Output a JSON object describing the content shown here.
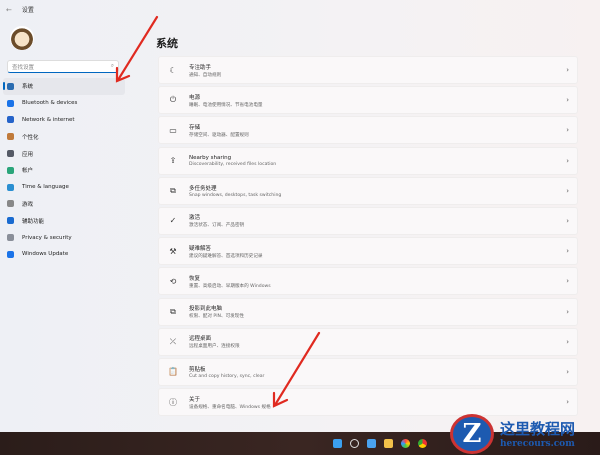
{
  "window": {
    "back": "←",
    "title": "设置"
  },
  "search": {
    "placeholder": "查找设置",
    "icon": "⌕"
  },
  "nav": [
    {
      "label": "系统",
      "color": "#2b6cb0"
    },
    {
      "label": "Bluetooth & devices",
      "color": "#1a73e8"
    },
    {
      "label": "Network & internet",
      "color": "#2563c9"
    },
    {
      "label": "个性化",
      "color": "#c07a3a"
    },
    {
      "label": "应用",
      "color": "#555a66"
    },
    {
      "label": "帐户",
      "color": "#2aa57a"
    },
    {
      "label": "Time & language",
      "color": "#2a8fd1"
    },
    {
      "label": "游戏",
      "color": "#888"
    },
    {
      "label": "辅助功能",
      "color": "#1a6bd0"
    },
    {
      "label": "Privacy & security",
      "color": "#8a8f99"
    },
    {
      "label": "Windows Update",
      "color": "#1a73e8"
    }
  ],
  "main": {
    "heading": "系统",
    "cards": [
      {
        "icon": "☾",
        "title": "专注助手",
        "sub": "通知、自动规则"
      },
      {
        "icon": "⏻",
        "title": "电源",
        "sub": "睡眠、电池使用情况、节省电池电量"
      },
      {
        "icon": "▭",
        "title": "存储",
        "sub": "存储空间、驱动器、配置规则"
      },
      {
        "icon": "⇪",
        "title": "Nearby sharing",
        "sub": "Discoverability, received files location"
      },
      {
        "icon": "⧉",
        "title": "多任务处理",
        "sub": "Snap windows, desktops, task switching"
      },
      {
        "icon": "✓",
        "title": "激活",
        "sub": "激活状态、订阅、产品密钥"
      },
      {
        "icon": "⚒",
        "title": "疑难解答",
        "sub": "建议的疑难解答、首选项和历史记录"
      },
      {
        "icon": "⟲",
        "title": "恢复",
        "sub": "重置、高级启动、早期版本的 Windows"
      },
      {
        "icon": "⧉",
        "title": "投影到此电脑",
        "sub": "权限、配对 PIN、可发现性"
      },
      {
        "icon": "⤫",
        "title": "远程桌面",
        "sub": "远程桌面用户、连接权限"
      },
      {
        "icon": "📋",
        "title": "剪贴板",
        "sub": "Cut and copy history, sync, clear"
      },
      {
        "icon": "ⓘ",
        "title": "关于",
        "sub": "设备规格、重命名电脑、Windows 规格"
      }
    ],
    "chevron": "›"
  },
  "watermark": {
    "letter": "Z",
    "cn": "这里教程网",
    "en": "herecours.com"
  },
  "colors": {
    "accent": "#0067c0",
    "arrow": "#e02a20",
    "taskbar": "#2f201d"
  }
}
